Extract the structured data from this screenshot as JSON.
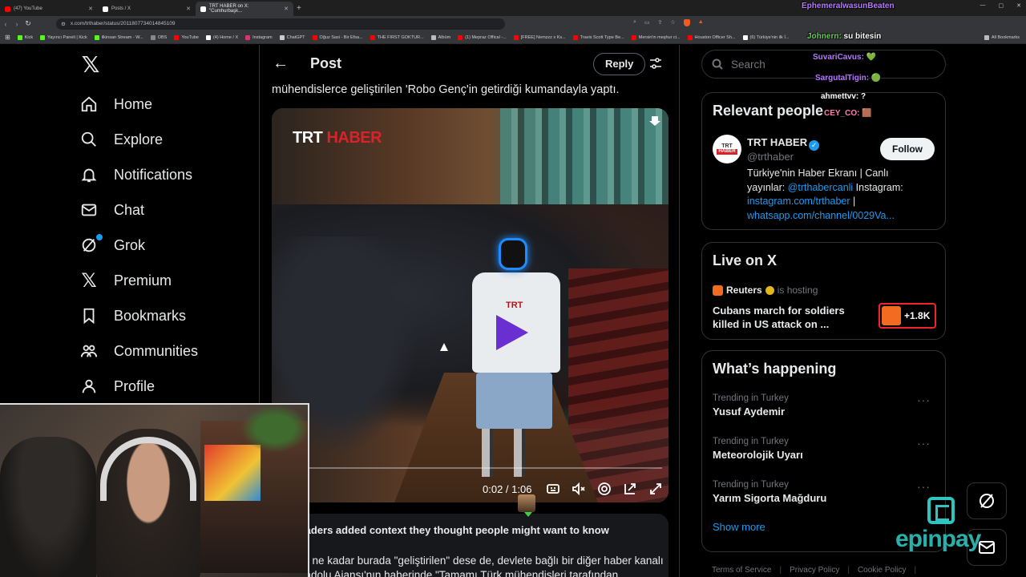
{
  "browser": {
    "tabs": [
      {
        "label": "(47) YouTube",
        "color": "#ff0000",
        "active": false
      },
      {
        "label": "Posts / X",
        "color": "#ffffff",
        "active": false
      },
      {
        "label": "TRT HABER on X: \"Cumhurbaşk...",
        "color": "#ffffff",
        "active": true
      }
    ],
    "url": "x.com/trthaber/status/2011807734014845109",
    "bookmarks": [
      {
        "label": "Kick",
        "color": "#53fc18"
      },
      {
        "label": "Yayıncı Paneli | Kick",
        "color": "#53fc18"
      },
      {
        "label": "ilkinsan Stream - W...",
        "color": "#53fc18"
      },
      {
        "label": "OBS",
        "color": "#888888"
      },
      {
        "label": "YouTube",
        "color": "#ff0000"
      },
      {
        "label": "(4) Home / X",
        "color": "#ffffff"
      },
      {
        "label": "Instagram",
        "color": "#e1306c"
      },
      {
        "label": "ChatGPT",
        "color": "#cccccc"
      },
      {
        "label": "Oğuz Sasi - Bir Efsa...",
        "color": "#ff0000"
      },
      {
        "label": "THE FIRST GOKTUR...",
        "color": "#ff0000"
      },
      {
        "label": "Albüm",
        "color": "#bbbbbb"
      },
      {
        "label": "(1) Mepraz Offical -...",
        "color": "#ff0000"
      },
      {
        "label": "[FREE] Nemzzz x Ks...",
        "color": "#ff0000"
      },
      {
        "label": "Travis Scott Type Be...",
        "color": "#ff0000"
      },
      {
        "label": "Mersin'in meşhur ci...",
        "color": "#ff0000"
      },
      {
        "label": "Houston Officer Sh...",
        "color": "#ff0000"
      },
      {
        "label": "(6) Türkiye'nin ilk İ...",
        "color": "#ffffff"
      },
      {
        "label": "All Bookmarks",
        "color": "#bbbbbb"
      }
    ]
  },
  "nav": {
    "items": [
      {
        "label": "Home",
        "icon": "home-icon"
      },
      {
        "label": "Explore",
        "icon": "search-icon"
      },
      {
        "label": "Notifications",
        "icon": "bell-icon"
      },
      {
        "label": "Chat",
        "icon": "mail-icon"
      },
      {
        "label": "Grok",
        "icon": "grok-icon"
      },
      {
        "label": "Premium",
        "icon": "x-premium-icon"
      },
      {
        "label": "Bookmarks",
        "icon": "bookmark-icon"
      },
      {
        "label": "Communities",
        "icon": "communities-icon"
      },
      {
        "label": "Profile",
        "icon": "profile-icon"
      }
    ]
  },
  "post": {
    "header_title": "Post",
    "reply_label": "Reply",
    "text": "mühendislerce geliştirilen 'Robo Genç'in getirdiği kumandayla yaptı.",
    "video": {
      "watermark_trt": "TRT",
      "watermark_haber": "HABER",
      "robot_logo": "TRT",
      "time": "0:02 / 1:06",
      "progress": 0.03
    },
    "context_title": "Readers added context they thought people might want to know",
    "context_line1": "Her ne kadar burada \"geliştirilen\" dese de, devlete bağlı bir diğer haber kanalı",
    "context_line2": "Anadolu Ajansı'nın haberinde \"Tamamı Türk mühendisleri tarafından"
  },
  "right": {
    "search_placeholder": "Search",
    "relevant": {
      "title": "Relevant people",
      "avatar_top": "TRT",
      "avatar_bottom": "HABER",
      "name": "TRT HABER",
      "handle": "@trthaber",
      "follow_label": "Follow",
      "bio_1": "Türkiye'nin Haber Ekranı | Canlı",
      "bio_2_prefix": "yayınlar: ",
      "bio_2_link": "@trthabercanli",
      "bio_2_suffix": " Instagram:",
      "bio_3_link": "instagram.com/trthaber",
      "bio_3_suffix": " |",
      "bio_4_link": "whatsapp.com/channel/0029Va..."
    },
    "live": {
      "title": "Live on X",
      "host": "Reuters",
      "hosting_text": "is hosting",
      "headline": "Cubans march for soldiers killed in US attack on ...",
      "listeners": "+1.8K"
    },
    "happening": {
      "title": "What’s happening",
      "trends": [
        {
          "category": "Trending in Turkey",
          "name": "Yusuf Aydemir"
        },
        {
          "category": "Trending in Turkey",
          "name": "Meteorolojik Uyarı"
        },
        {
          "category": "Trending in Turkey",
          "name": "Yarım Sigorta Mağduru"
        }
      ],
      "show_more": "Show more"
    },
    "footer": [
      "Terms of Service",
      "Privacy Policy",
      "Cookie Policy"
    ]
  },
  "overlay": {
    "chat": [
      {
        "user": "EphemeralwasunBeaten",
        "msg": "",
        "color": "c-purple"
      },
      {
        "user": "Johnern:",
        "msg": " su bitesin",
        "color": "c-green"
      },
      {
        "user": "SuvariCavus:",
        "msg": " 💚",
        "color": "c-purple"
      },
      {
        "user": "SargutalTigin:",
        "msg": " 🟢",
        "color": "c-purple"
      },
      {
        "user": "ahmettvv:",
        "msg": " ?",
        "color": "c-white"
      },
      {
        "user": "CEY_CO:",
        "msg": " 🟫",
        "color": "c-pink"
      }
    ],
    "sponsor": "epinpay"
  }
}
